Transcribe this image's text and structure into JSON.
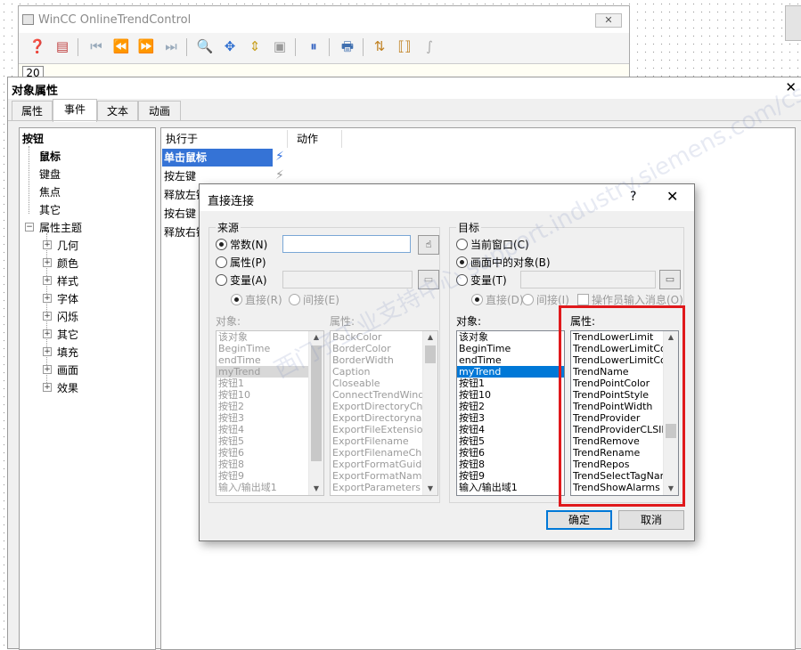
{
  "trend_window": {
    "title": "WinCC OnlineTrendControl",
    "close": "✕",
    "ruler_value": "20",
    "toolbar_icons": [
      "help-icon",
      "config-icon",
      "first-icon",
      "prev-icon",
      "next-icon",
      "last-icon",
      "zoom-icon",
      "move-icon",
      "zoom-area-icon",
      "original-view-icon",
      "stop-icon",
      "print-icon",
      "select-trend-icon",
      "ruler-icon",
      "statistics-icon"
    ]
  },
  "object_properties": {
    "title": "对象属性",
    "close": "✕",
    "tabs": [
      "属性",
      "事件",
      "文本",
      "动画"
    ],
    "active_tab": "事件",
    "tree": {
      "root": "按钮",
      "children": [
        "鼠标",
        "键盘",
        "焦点",
        "其它"
      ],
      "selected": "鼠标",
      "group": "属性主题",
      "group_children": [
        "几何",
        "颜色",
        "样式",
        "字体",
        "闪烁",
        "其它",
        "填充",
        "画面",
        "效果"
      ]
    },
    "events_table": {
      "headers": [
        "执行于",
        "动作"
      ],
      "rows": [
        "单击鼠标",
        "按左键",
        "释放左键",
        "按右键",
        "释放右键"
      ],
      "selected": "单击鼠标"
    }
  },
  "dialog": {
    "title": "直接连接",
    "help": "?",
    "close": "✕",
    "source": {
      "label": "来源",
      "options": [
        "常数(N)",
        "属性(P)",
        "变量(A)"
      ],
      "selected": "常数(N)",
      "constant_value": "",
      "sub_options": [
        "直接(R)",
        "间接(E)"
      ],
      "objects_label": "对象:",
      "properties_label": "属性:",
      "objects": [
        "该对象",
        "BeginTime",
        "endTime",
        "myTrend",
        "按钮1",
        "按钮10",
        "按钮2",
        "按钮3",
        "按钮4",
        "按钮5",
        "按钮6",
        "按钮8",
        "按钮9",
        "输入/输出域1"
      ],
      "selected_object": "myTrend",
      "properties": [
        "BackColor",
        "BorderColor",
        "BorderWidth",
        "Caption",
        "Closeable",
        "ConnectTrendWindows",
        "ExportDirectoryChanged",
        "ExportDirectoryname",
        "ExportFileExtension",
        "ExportFilename",
        "ExportFilenameChanged",
        "ExportFormatGuid",
        "ExportFormatName",
        "ExportParameters"
      ]
    },
    "target": {
      "label": "目标",
      "options": [
        "当前窗口(C)",
        "画面中的对象(B)",
        "变量(T)"
      ],
      "selected": "画面中的对象(B)",
      "sub_options": [
        "直接(D)",
        "间接(I)"
      ],
      "operator_message": "操作员输入消息(O)",
      "objects_label": "对象:",
      "properties_label": "属性:",
      "objects": [
        "该对象",
        "BeginTime",
        "endTime",
        "myTrend",
        "按钮1",
        "按钮10",
        "按钮2",
        "按钮3",
        "按钮4",
        "按钮5",
        "按钮6",
        "按钮8",
        "按钮9",
        "输入/输出域1"
      ],
      "selected_object": "myTrend",
      "properties": [
        "TrendLowerLimit",
        "TrendLowerLimitColor",
        "TrendLowerLimitColoring",
        "TrendName",
        "TrendPointColor",
        "TrendPointStyle",
        "TrendPointWidth",
        "TrendProvider",
        "TrendProviderCLSID",
        "TrendRemove",
        "TrendRename",
        "TrendRepos",
        "TrendSelectTagName",
        "TrendShowAlarms"
      ]
    },
    "ok": "确定",
    "cancel": "取消",
    "highlight_color": "#e0191c",
    "watermark": "西门子工业支持中心 support.industry.siemens.com/cs"
  }
}
